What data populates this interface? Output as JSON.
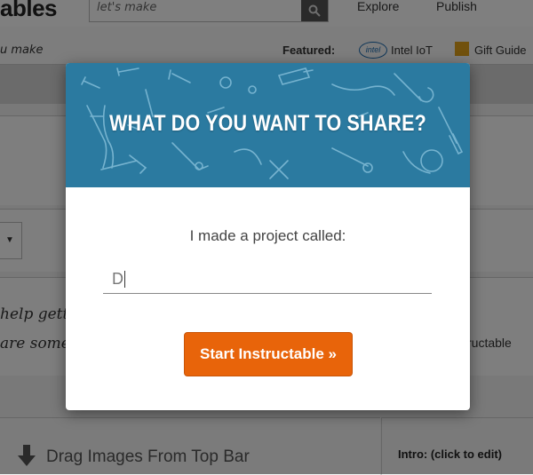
{
  "site": {
    "logo_text": "ables",
    "search_hint": "let's make",
    "nav": [
      "Explore",
      "Publish"
    ],
    "tagline": "u make",
    "featured_label": "Featured:",
    "featured_links": [
      "Intel IoT",
      "Gift Guide"
    ],
    "intel_logo_text": "intel"
  },
  "background_page": {
    "hand_lines": [
      "help gett",
      "are some"
    ],
    "right_text": "ructable",
    "drag_text": "Drag Images From Top Bar",
    "intro_text": "Intro: (click to edit)"
  },
  "modal": {
    "title": "WHAT DO YOU WANT TO SHARE?",
    "prompt": "I made a project called:",
    "input_value": "D",
    "button_label": "Start Instructable »"
  },
  "colors": {
    "header_blue": "#2b7aa0",
    "button_orange": "#e8640a"
  }
}
